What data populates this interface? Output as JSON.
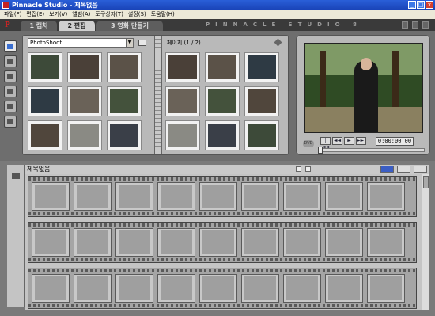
{
  "window": {
    "title": "Pinnacle Studio - 제목없음",
    "buttons": [
      "_",
      "□",
      "x"
    ]
  },
  "menu": [
    "파일(F)",
    "편집(E)",
    "보기(V)",
    "앨범(A)",
    "도구상자(T)",
    "설정(S)",
    "도움말(H)"
  ],
  "nav": {
    "logo": "P",
    "tabs": [
      "1 캡처",
      "2 편집",
      "3 영화 만들기"
    ],
    "active_tab": 1,
    "brand": "PINNACLE STUDIO 8"
  },
  "album": {
    "source": "PhotoShoot",
    "page_label": "페이지 (1 / 2)",
    "left_thumbs": 9,
    "right_thumbs": 9
  },
  "player": {
    "dvd": "DVD",
    "timecode": "0:00:00.00",
    "controls": [
      "|◄◄",
      "◄◄",
      "►",
      "►►|"
    ]
  },
  "movie": {
    "title": "제목없음",
    "strips": 3,
    "cells_per_strip": 9
  },
  "colors": {
    "titlebar": "#2a5fd8",
    "album_bg": "#b9b9b9",
    "workspace": "#6e6e6e"
  }
}
